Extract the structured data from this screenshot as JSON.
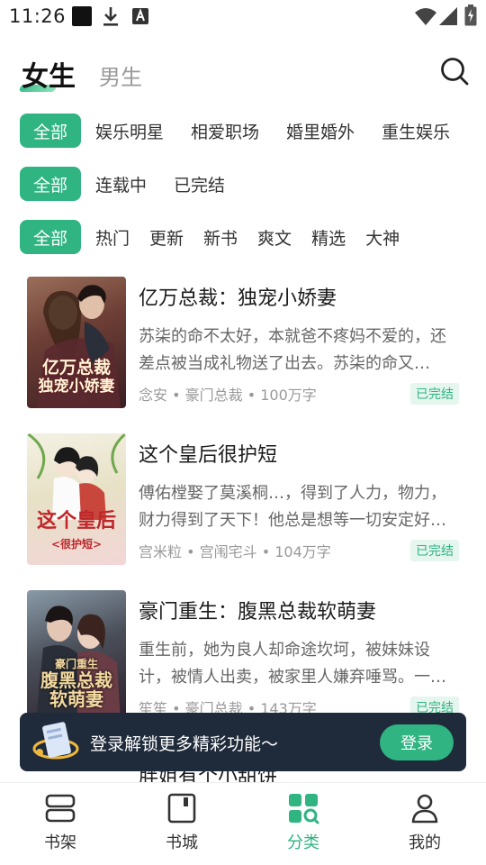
{
  "status_bar": {
    "time": "11:26",
    "icons": [
      "square-icon",
      "download-icon",
      "a-icon",
      "wifi-icon",
      "signal-icon",
      "battery-icon"
    ]
  },
  "header": {
    "tabs": [
      {
        "label": "女生",
        "active": true
      },
      {
        "label": "男生",
        "active": false
      }
    ],
    "search_icon": "search-icon"
  },
  "filters": {
    "category": [
      "全部",
      "娱乐明星",
      "相爱职场",
      "婚里婚外",
      "重生娱乐"
    ],
    "status": [
      "全部",
      "连载中",
      "已完结"
    ],
    "sort": [
      "全部",
      "热门",
      "更新",
      "新书",
      "爽文",
      "精选",
      "大神"
    ]
  },
  "books": [
    {
      "title": "亿万总裁：独宠小娇妻",
      "desc": "苏柒的命不太好，本就爸不疼妈不爱的，还差点被当成礼物送了出去。苏柒的命又…",
      "meta": "念安 • 豪门总裁 • 100万字",
      "status": "已完结",
      "cover_text": "亿万总裁\n独宠小娇妻"
    },
    {
      "title": "这个皇后很护短",
      "desc": "傅佑樘娶了莫溪桐…，得到了人力，物力，财力得到了天下！他总是想等一切安定好…",
      "meta": "宫米粒 • 宫闱宅斗 • 104万字",
      "status": "已完结",
      "cover_text": "这个皇后\n<很护短>"
    },
    {
      "title": "豪门重生：腹黑总裁软萌妻",
      "desc": "重生前，她为良人却命途坎坷，被妹妹设计，被情人出卖，被家里人嫌弃唾骂。一…",
      "meta": "笙笙 • 豪门总裁 • 143万字",
      "status": "已完结",
      "cover_text": "豪门重生\n腹黑总裁\n软萌妻"
    },
    {
      "title": "胖姐有个小甜饼"
    }
  ],
  "login_banner": {
    "text": "登录解锁更多精彩功能～",
    "button": "登录"
  },
  "bottom_nav": [
    {
      "label": "书架",
      "icon": "bookshelf-icon",
      "active": false
    },
    {
      "label": "书城",
      "icon": "bookstore-icon",
      "active": false
    },
    {
      "label": "分类",
      "icon": "category-icon",
      "active": true
    },
    {
      "label": "我的",
      "icon": "profile-icon",
      "active": false
    }
  ],
  "colors": {
    "accent": "#2fb482",
    "banner_bg": "#1f2a3a"
  }
}
